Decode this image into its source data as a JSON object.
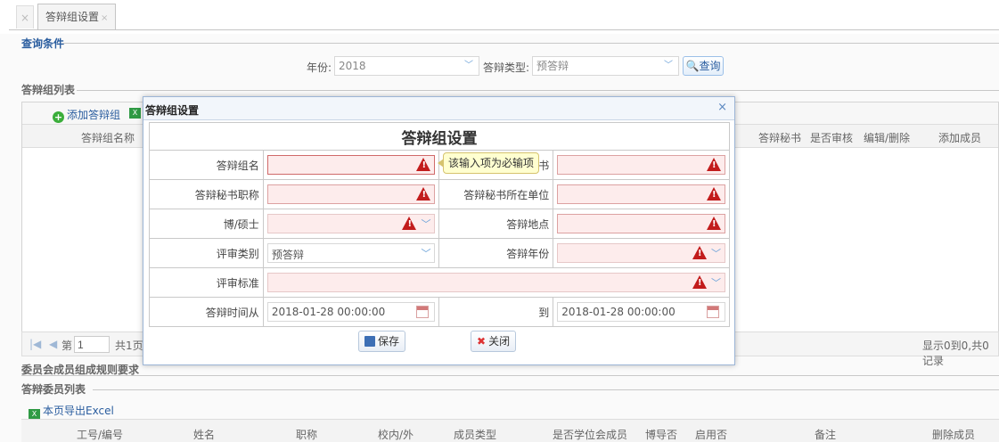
{
  "tabs": {
    "closed_tab_x": "×",
    "active_label": "答辩组设置",
    "active_close": "×"
  },
  "query": {
    "section_title": "查询条件",
    "year_label": "年份:",
    "year_value": "2018",
    "type_label": "答辩类型:",
    "type_value": "预答辩",
    "search_label": "查询"
  },
  "group_list": {
    "section_title": "答辩组列表",
    "add_label": "添加答辩组",
    "columns": [
      "答辩组名称",
      "答辩秘书",
      "是否审核",
      "编辑/删除",
      "添加成员"
    ]
  },
  "pager": {
    "page_label": "第",
    "page_value": "1",
    "total_label": "共1页",
    "summary": "显示0到0,共0记录"
  },
  "rules_title": "委员会成员组成规则要求",
  "member_list": {
    "section_title": "答辩委员列表",
    "export_label": "本页导出Excel",
    "columns": [
      "工号/编号",
      "姓名",
      "职称",
      "校内/外",
      "成员类型",
      "是否学位会成员",
      "博导否",
      "启用否",
      "备注",
      "删除成员"
    ]
  },
  "modal": {
    "window_title": "答辩组设置",
    "close": "×",
    "form_title": "答辩组设置",
    "fields": {
      "group_name": "答辩组名",
      "secretary": "书",
      "secretary_title": "答辩秘书职称",
      "secretary_unit": "答辩秘书所在单位",
      "degree": "博/硕士",
      "location": "答辩地点",
      "review_type": "评审类别",
      "review_type_value": "预答辩",
      "year": "答辩年份",
      "standard": "评审标准",
      "time_from": "答辩时间从",
      "time_from_value": "2018-01-28 00:00:00",
      "time_to": "到",
      "time_to_value": "2018-01-28 00:00:00"
    },
    "tooltip": "该输入项为必输项",
    "save_label": "保存",
    "close_label": "关闭"
  }
}
